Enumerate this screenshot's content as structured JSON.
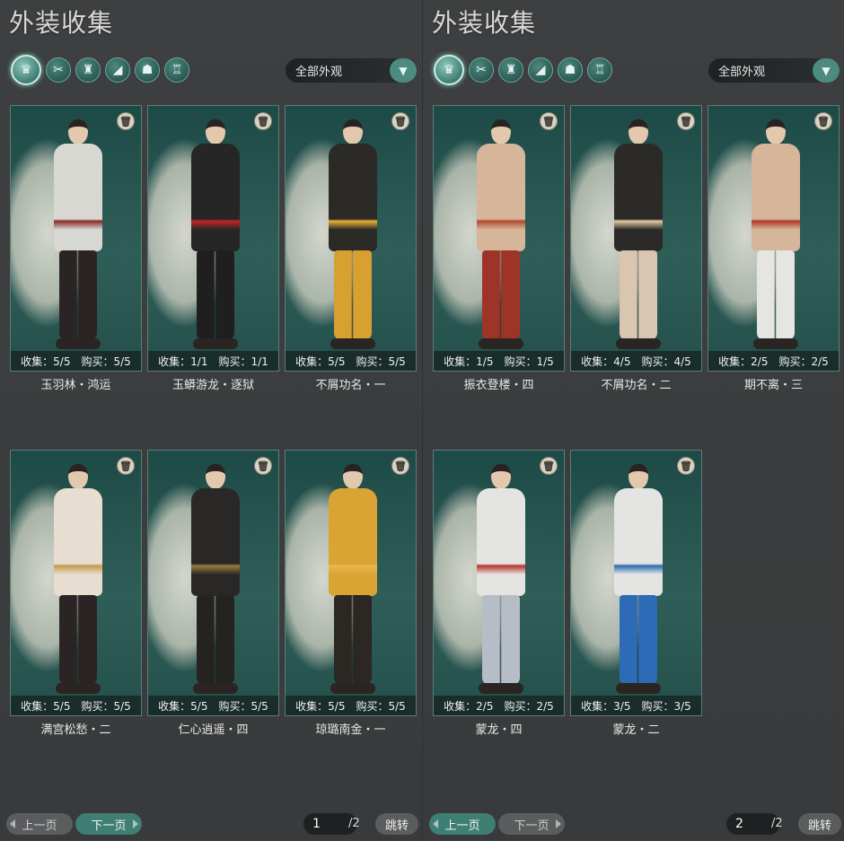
{
  "colors": {
    "accent": "#3e7e73",
    "card_bg": "#1d4a46",
    "panel_bg": "#3a3c3d"
  },
  "icons": {
    "trash": "trash-icon",
    "dropdown": "chevron-down-icon",
    "categories": [
      "full-outfit-icon",
      "hair-icon",
      "top-icon",
      "shoe-icon",
      "mask-icon",
      "accessory-icon"
    ]
  },
  "panels": [
    {
      "title": "外装收集",
      "filter": {
        "selected": "全部外观"
      },
      "active_category": 0,
      "cards": [
        {
          "name": "玉羽林・鸿运",
          "collect": "收集：5/5",
          "buy": "购买：5/5",
          "top": "#d8d8d2",
          "bottom": "#2a2524",
          "accent": "#8a2a2a"
        },
        {
          "name": "玉蟒游龙・逐狱",
          "collect": "收集：1/1",
          "buy": "购买：1/1",
          "top": "#262626",
          "bottom": "#1f1f20",
          "accent": "#c2242a"
        },
        {
          "name": "不屑功名・一",
          "collect": "收集：5/5",
          "buy": "购买：5/5",
          "top": "#2b2a26",
          "bottom": "#d7a030",
          "accent": "#e8b035"
        },
        {
          "name": "满宫松愁・二",
          "collect": "收集：5/5",
          "buy": "购买：5/5",
          "top": "#e7ddd0",
          "bottom": "#2a2524",
          "accent": "#c69a4a"
        },
        {
          "name": "仁心逍遥・四",
          "collect": "收集：5/5",
          "buy": "购买：5/5",
          "top": "#2a2826",
          "bottom": "#25231f",
          "accent": "#9b7b3e"
        },
        {
          "name": "琼璐南金・一",
          "collect": "收集：5/5",
          "buy": "购买：5/5",
          "top": "#d9a433",
          "bottom": "#2b2723",
          "accent": "#e7b84a"
        }
      ],
      "pager": {
        "prev": "上一页",
        "next": "下一页",
        "page": "1",
        "total": "/2",
        "jump": "跳转"
      }
    },
    {
      "title": "外装收集",
      "filter": {
        "selected": "全部外观"
      },
      "active_category": 0,
      "cards": [
        {
          "name": "振衣登楼・四",
          "collect": "收集：1/5",
          "buy": "购买：1/5",
          "top": "#d6b69a",
          "bottom": "#9e3327",
          "accent": "#b34a30"
        },
        {
          "name": "不屑功名・二",
          "collect": "收集：4/5",
          "buy": "购买：4/5",
          "top": "#2b2a26",
          "bottom": "#d9c5b0",
          "accent": "#e1c8a4"
        },
        {
          "name": "期不离・三",
          "collect": "收集：2/5",
          "buy": "购买：2/5",
          "top": "#d6b69a",
          "bottom": "#e5e5e2",
          "accent": "#b03a2a"
        },
        {
          "name": "蒙龙・四",
          "collect": "收集：2/5",
          "buy": "购买：2/5",
          "top": "#e4e4e2",
          "bottom": "#b7bdc7",
          "accent": "#b4352c"
        },
        {
          "name": "蒙龙・二",
          "collect": "收集：3/5",
          "buy": "购买：3/5",
          "top": "#e4e4e2",
          "bottom": "#2e6bb6",
          "accent": "#2e6bb6"
        }
      ],
      "pager": {
        "prev": "上一页",
        "next": "下一页",
        "page": "2",
        "total": "/2",
        "jump": "跳转"
      }
    }
  ]
}
